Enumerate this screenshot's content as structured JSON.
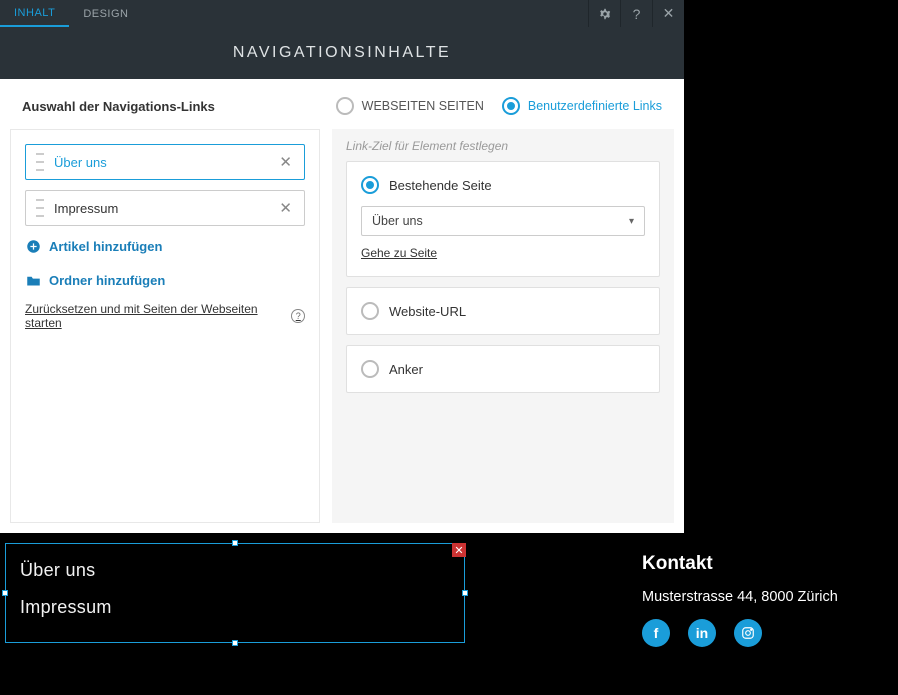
{
  "tabs": {
    "content": "INHALT",
    "design": "DESIGN"
  },
  "title": "NAVIGATIONSINHALTE",
  "sel": {
    "label": "Auswahl der Navigations-Links",
    "opt1": "WEBSEITEN SEITEN",
    "opt2": "Benutzerdefinierte Links"
  },
  "items": [
    {
      "label": "Über uns"
    },
    {
      "label": "Impressum"
    }
  ],
  "addArticle": "Artikel hinzufügen",
  "addFolder": "Ordner hinzufügen",
  "reset": "Zurücksetzen und mit Seiten der Webseiten starten",
  "right": {
    "legend": "Link-Ziel für Element festlegen",
    "existing": "Bestehende Seite",
    "select": "Über uns",
    "goto": "Gehe zu Seite",
    "url": "Website-URL",
    "anchor": "Anker"
  },
  "preview": {
    "items": [
      "Über uns",
      "Impressum"
    ]
  },
  "kontakt": {
    "title": "Kontakt",
    "addr": "Musterstrasse 44, 8000 Zürich"
  }
}
